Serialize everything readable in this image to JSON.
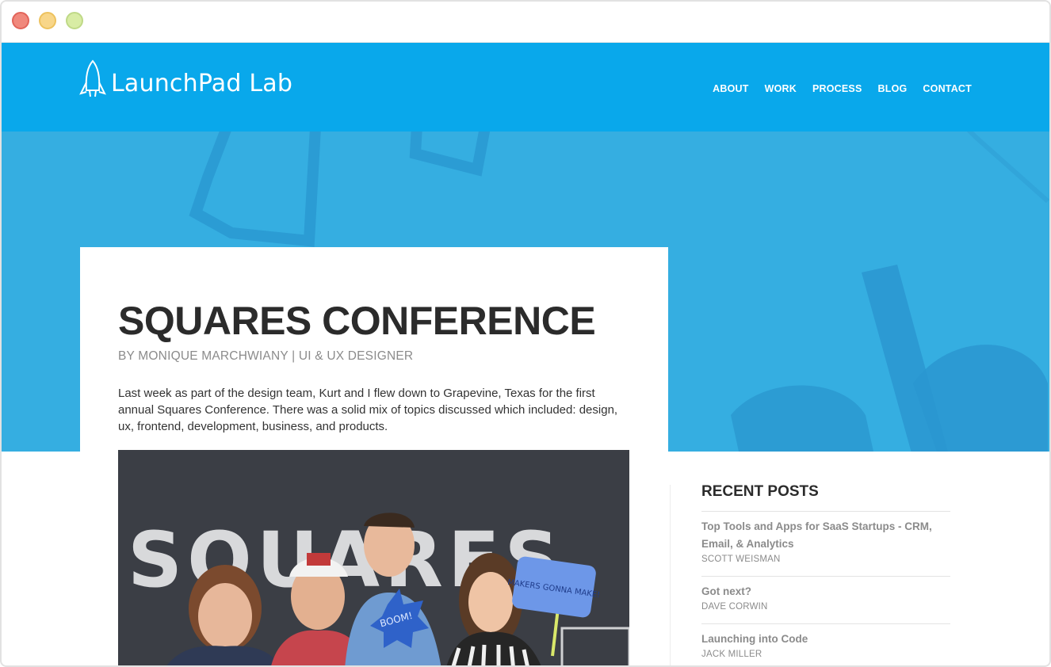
{
  "brand": {
    "name": "LaunchPad Lab"
  },
  "nav": {
    "items": [
      "ABOUT",
      "WORK",
      "PROCESS",
      "BLOG",
      "CONTACT"
    ]
  },
  "article": {
    "title": "SQUARES CONFERENCE",
    "byline": "BY MONIQUE MARCHWIANY | UI & UX DESIGNER",
    "intro": "Last week as part of the design team, Kurt and I flew down to Grapevine, Texas for the first annual Squares Conference. There was a solid mix of topics discussed which included: design, ux, frontend, development, business, and products.",
    "photo": {
      "backdrop_text": "SQUARES",
      "sign_left": "BOOM!",
      "sign_right": "MAKERS GONNA MAKE!"
    }
  },
  "sidebar": {
    "title": "RECENT POSTS",
    "posts": [
      {
        "title": "Top Tools and Apps for SaaS Startups - CRM, Email, & Analytics",
        "author": "SCOTT WEISMAN"
      },
      {
        "title": "Got next?",
        "author": "DAVE CORWIN"
      },
      {
        "title": "Launching into Code",
        "author": "JACK MILLER"
      }
    ]
  },
  "colors": {
    "nav_bg": "#09a8eb",
    "hero_bg": "#33ace0",
    "title_text": "#2b2b2b",
    "muted_text": "#8b8b8b"
  }
}
